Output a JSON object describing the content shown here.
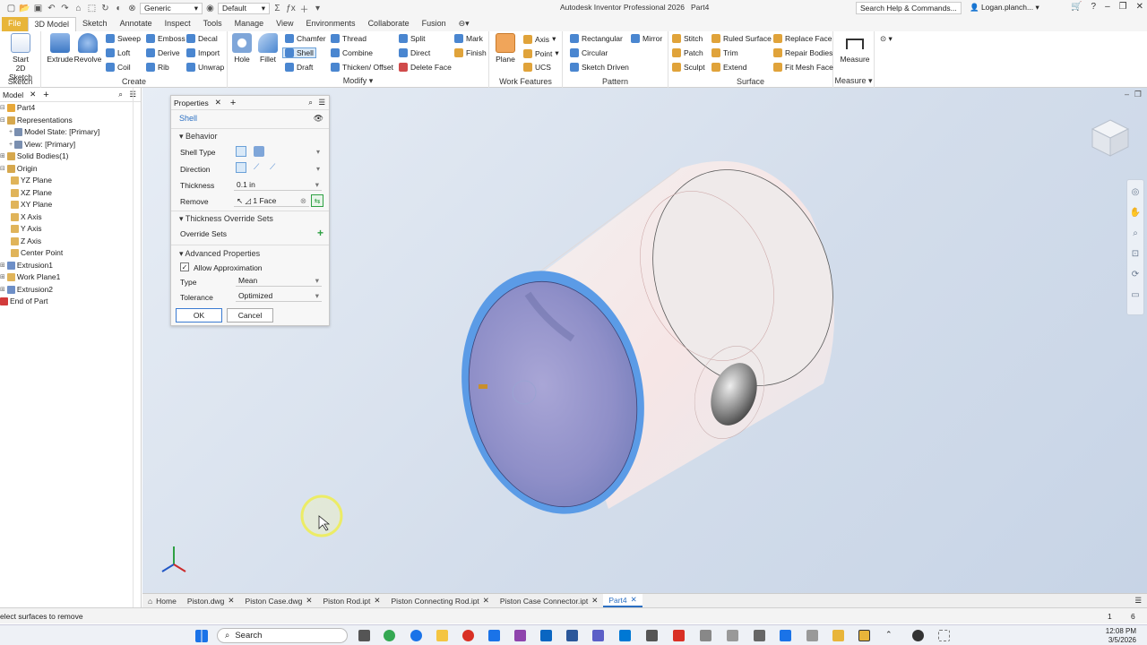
{
  "titlebar": {
    "appearance_select": "Generic",
    "material_select": "Default",
    "app_title": "Autodesk Inventor Professional 2026",
    "doc_title": "Part4",
    "search_placeholder": "Search Help & Commands...",
    "user": "Logan.planch..."
  },
  "tabs": [
    "File",
    "3D Model",
    "Sketch",
    "Annotate",
    "Inspect",
    "Tools",
    "Manage",
    "View",
    "Environments",
    "Collaborate",
    "Fusion"
  ],
  "ribbon": {
    "sketch": {
      "title": "Sketch",
      "start": "Start",
      "start2": "2D Sketch"
    },
    "create": {
      "title": "Create",
      "extrude": "Extrude",
      "revolve": "Revolve",
      "items": [
        "Sweep",
        "Emboss",
        "Decal",
        "Loft",
        "Derive",
        "Import",
        "Coil",
        "Rib",
        "Unwrap"
      ]
    },
    "modify": {
      "title": "Modify",
      "hole": "Hole",
      "fillet": "Fillet",
      "col1": [
        "Chamfer",
        "Shell",
        "Draft"
      ],
      "col2": [
        "Thread",
        "Combine",
        "Thicken/ Offset"
      ],
      "col3": [
        "Split",
        "Direct",
        "Delete Face"
      ],
      "col4": [
        "Mark",
        "Finish"
      ]
    },
    "work": {
      "title": "Work Features",
      "plane": "Plane",
      "items": [
        "Axis",
        "Point",
        "UCS"
      ]
    },
    "pattern": {
      "title": "Pattern",
      "items": [
        "Rectangular",
        "Circular",
        "Sketch Driven"
      ],
      "mirror": "Mirror"
    },
    "surface": {
      "title": "Surface",
      "col1": [
        "Stitch",
        "Patch",
        "Sculpt"
      ],
      "col2": [
        "Ruled Surface",
        "Trim",
        "Extend"
      ],
      "col3": [
        "Replace Face",
        "Repair Bodies",
        "Fit Mesh Face"
      ]
    },
    "measure": {
      "title": "Measure",
      "label": "Measure"
    }
  },
  "browser": {
    "tab": "Model",
    "items": [
      {
        "label": "Part4",
        "color": "#e7a83a"
      },
      {
        "label": "Representations",
        "color": "#d6a84e"
      },
      {
        "label": "Model State: [Primary]",
        "color": "#7a8fb0"
      },
      {
        "label": "View: [Primary]",
        "color": "#7a8fb0"
      },
      {
        "label": "Solid Bodies(1)",
        "color": "#d6a84e"
      },
      {
        "label": "Origin",
        "color": "#d6a84e"
      },
      {
        "label": "YZ Plane",
        "color": "#e0b45a"
      },
      {
        "label": "XZ Plane",
        "color": "#e0b45a"
      },
      {
        "label": "XY Plane",
        "color": "#e0b45a"
      },
      {
        "label": "X Axis",
        "color": "#e0b45a"
      },
      {
        "label": "Y Axis",
        "color": "#e0b45a"
      },
      {
        "label": "Z Axis",
        "color": "#e0b45a"
      },
      {
        "label": "Center Point",
        "color": "#e0b45a"
      },
      {
        "label": "Extrusion1",
        "color": "#6e8fc7"
      },
      {
        "label": "Work Plane1",
        "color": "#e0b45a"
      },
      {
        "label": "Extrusion2",
        "color": "#6e8fc7"
      },
      {
        "label": "End of Part",
        "color": "#d23b3b"
      }
    ]
  },
  "properties": {
    "tab": "Properties",
    "feature": "Shell",
    "behavior": "Behavior",
    "shell_type": "Shell Type",
    "direction": "Direction",
    "thickness_label": "Thickness",
    "thickness_value": "0.1 in",
    "remove_label": "Remove",
    "remove_value": "1 Face",
    "override_section": "Thickness Override Sets",
    "override_sets": "Override Sets",
    "advanced": "Advanced Properties",
    "allow_approx": "Allow Approximation",
    "type_label": "Type",
    "type_value": "Mean",
    "tolerance_label": "Tolerance",
    "tolerance_value": "Optimized",
    "ok": "OK",
    "cancel": "Cancel"
  },
  "doc_tabs": [
    "Home",
    "Piston.dwg",
    "Piston Case.dwg",
    "Piston Rod.ipt",
    "Piston Connecting Rod.ipt",
    "Piston Case Connector.ipt",
    "Part4"
  ],
  "status": {
    "message": "elect surfaces to remove",
    "n1": "1",
    "n2": "6"
  },
  "taskbar": {
    "search": "Search",
    "time": "12:08 PM",
    "date": "3/5/2026"
  },
  "colors": {
    "accent": "#2b6fc2",
    "file_tab": "#e8b53a",
    "shell_inner": "#8f93c9",
    "shell_rim": "#5b9be6"
  }
}
